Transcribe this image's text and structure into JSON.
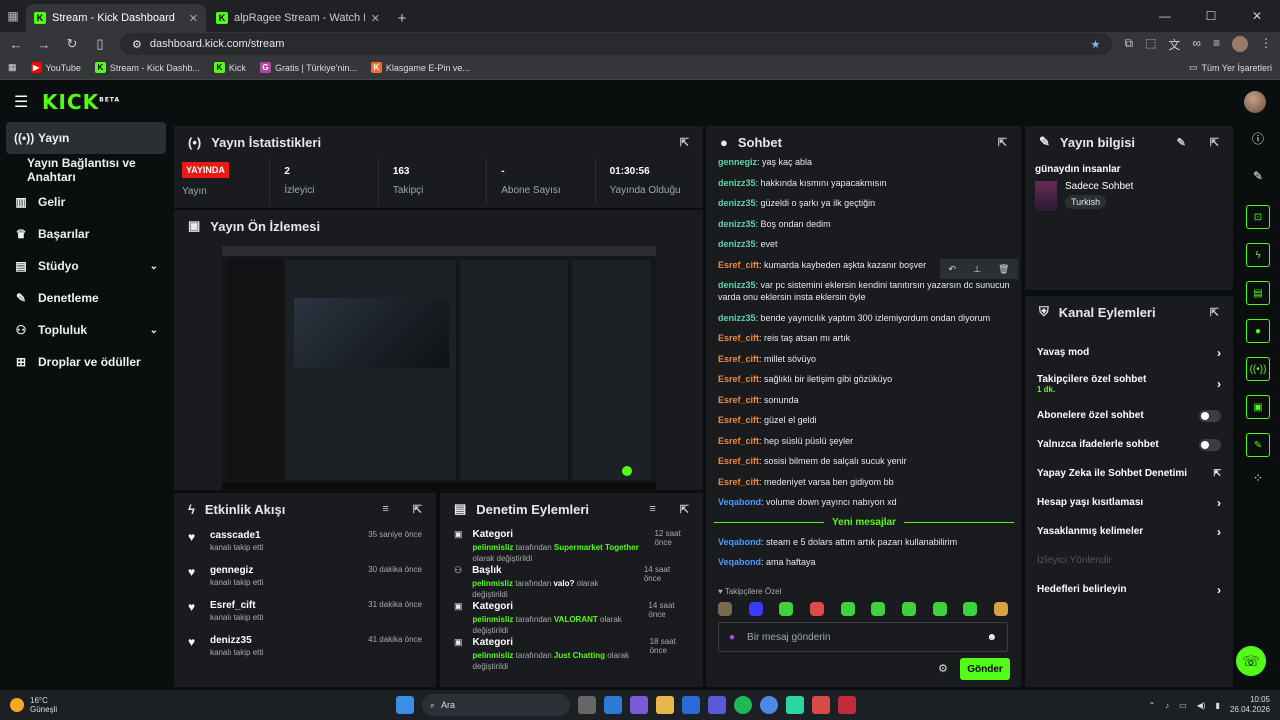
{
  "browser": {
    "tabs": [
      {
        "title": "Stream - Kick Dashboard",
        "active": true
      },
      {
        "title": "alpRagee Stream - Watch Live o",
        "active": false
      }
    ],
    "url": "dashboard.kick.com/stream",
    "bookmarks": [
      "YouTube",
      "Stream - Kick Dashb...",
      "Kick",
      "Gratis | Türkiye'nin...",
      "Klasgame E-Pin ve..."
    ],
    "all_bookmarks": "Tüm Yer İşaretleri"
  },
  "app": {
    "logo": "KICK",
    "logo_badge": "BETA"
  },
  "sidebar": {
    "items": [
      {
        "label": "Yayın",
        "icon": "broadcast-icon"
      },
      {
        "label": "Yayın Bağlantısı ve Anahtarı",
        "icon": ""
      },
      {
        "label": "Gelir",
        "icon": "chart-icon"
      },
      {
        "label": "Başarılar",
        "icon": "trophy-icon"
      },
      {
        "label": "Stüdyo",
        "icon": "studio-icon"
      },
      {
        "label": "Denetleme",
        "icon": "wrench-icon"
      },
      {
        "label": "Topluluk",
        "icon": "community-icon"
      },
      {
        "label": "Droplar ve ödüller",
        "icon": "gift-icon"
      }
    ]
  },
  "stats": {
    "title": "Yayın İstatistikleri",
    "live_badge": "YAYINDA",
    "live_label": "Yayın",
    "items": [
      {
        "value": "2",
        "label": "İzleyici"
      },
      {
        "value": "163",
        "label": "Takipçi"
      },
      {
        "value": "-",
        "label": "Abone Sayısı"
      },
      {
        "value": "01:30:56",
        "label": "Yayında Olduğu"
      }
    ]
  },
  "preview": {
    "title": "Yayın Ön İzlemesi"
  },
  "activity": {
    "title": "Etkinlik Akışı",
    "items": [
      {
        "name": "casscade1",
        "sub": "kanalı takip etti",
        "time": "35 saniye önce"
      },
      {
        "name": "gennegiz",
        "sub": "kanalı takip etti",
        "time": "30 dakika önce"
      },
      {
        "name": "Esref_cift",
        "sub": "kanalı takip etti",
        "time": "31 dakika önce"
      },
      {
        "name": "denizz35",
        "sub": "kanalı takip etti",
        "time": "41 dakika önce"
      }
    ]
  },
  "modactions": {
    "title": "Denetim Eylemleri",
    "items": [
      {
        "type": "Kategori",
        "user": "pelinmisliz",
        "by": "tarafından",
        "value": "Supermarket Together",
        "after": "olarak değiştirildi",
        "time": "12 saat önce"
      },
      {
        "type": "Başlık",
        "user": "pelinmisliz",
        "by": "tarafından",
        "value": "valo?",
        "after": "olarak değiştirildi",
        "time": "14 saat önce"
      },
      {
        "type": "Kategori",
        "user": "pelinmisliz",
        "by": "tarafından",
        "value": "VALORANT",
        "after": "olarak değiştirildi",
        "time": "14 saat önce"
      },
      {
        "type": "Kategori",
        "user": "pelinmisliz",
        "by": "tarafından",
        "value": "Just Chatting",
        "after": "olarak değiştirildi",
        "time": "18 saat önce"
      }
    ]
  },
  "chat": {
    "title": "Sohbet",
    "messages": [
      {
        "user": "gennegiz",
        "color": "green",
        "text": "yaş kaç abla"
      },
      {
        "user": "denizz35",
        "color": "green",
        "text": "hakkında kısmını yapacakmısın"
      },
      {
        "user": "denizz35",
        "color": "green",
        "text": "güzeldi o şarkı ya ilk geçtiğin"
      },
      {
        "user": "denizz35",
        "color": "green",
        "text": "Boş ondan dedim"
      },
      {
        "user": "denizz35",
        "color": "green",
        "text": "evet"
      },
      {
        "user": "Esref_cift",
        "color": "orange",
        "text": "kumarda kaybeden aşkta kazanır boşver"
      },
      {
        "user": "denizz35",
        "color": "green",
        "text": "var pc sistemini eklersin kendini tanıtırsın yazarsın dc sunucun varda onu eklersin insta eklersin öyle"
      },
      {
        "user": "denizz35",
        "color": "green",
        "text": "bende yayıncılık yaptım 300 izlemiyordum ondan diyorum"
      },
      {
        "user": "Esref_cift",
        "color": "orange",
        "text": "reis taş atsan mı artık"
      },
      {
        "user": "Esref_cift",
        "color": "orange",
        "text": "millet sövüyo"
      },
      {
        "user": "Esref_cift",
        "color": "orange",
        "text": "sağlıklı bir iletişim gibi gözüküyo"
      },
      {
        "user": "Esref_cift",
        "color": "orange",
        "text": "sonunda"
      },
      {
        "user": "Esref_cift",
        "color": "orange",
        "text": "güzel el geldi"
      },
      {
        "user": "Esref_cift",
        "color": "orange",
        "text": "hep süslü püslü şeyler"
      },
      {
        "user": "Esref_cift",
        "color": "orange",
        "text": "sosisi bilmem de salçalı sucuk yenir"
      },
      {
        "user": "Esref_cift",
        "color": "orange",
        "text": "medeniyet varsa ben gidiyom bb"
      },
      {
        "user": "Veqabond",
        "color": "blue",
        "text": "volume down yayıncı nabıyon xd"
      }
    ],
    "new_messages": "Yeni mesajlar",
    "new": [
      {
        "user": "Veqabond",
        "color": "blue",
        "text": "steam e 5 dolars attım artık pazarı kullanabilirim"
      },
      {
        "user": "Veqabond",
        "color": "blue",
        "text": "ama haftaya"
      }
    ],
    "followers_only": "Takipçilere Özel",
    "input_placeholder": "Bir mesaj gönderin",
    "send": "Gönder"
  },
  "streaminfo": {
    "title": "Yayın bilgisi",
    "stream_title": "günaydın insanlar",
    "category": "Sadece Sohbet",
    "language": "Turkish"
  },
  "channelactions": {
    "title": "Kanal Eylemleri",
    "items": [
      {
        "label": "Yavaş mod",
        "kind": "chevron"
      },
      {
        "label": "Takipçilere özel sohbet",
        "sub": "1 dk.",
        "kind": "chevron"
      },
      {
        "label": "Abonelere özel sohbet",
        "kind": "toggle"
      },
      {
        "label": "Yalnızca ifadelerle sohbet",
        "kind": "toggle"
      },
      {
        "label": "Yapay Zeka ile Sohbet Denetimi",
        "kind": "external"
      },
      {
        "label": "Hesap yaşı kısıtlaması",
        "kind": "chevron"
      },
      {
        "label": "Yasaklanmış kelimeler",
        "kind": "chevron"
      },
      {
        "label": "İzleyici Yönlendir",
        "kind": "disabled"
      },
      {
        "label": "Hedefleri belirleyin",
        "kind": "chevron"
      }
    ]
  },
  "taskbar": {
    "temp": "16°C",
    "weather": "Güneşli",
    "search": "Ara",
    "time": "10:05",
    "date": "26.04.2026"
  },
  "colors": {
    "accent": "#53fc18",
    "live": "#e91916",
    "panel": "#191b1f",
    "bg": "#0b0e0f"
  }
}
